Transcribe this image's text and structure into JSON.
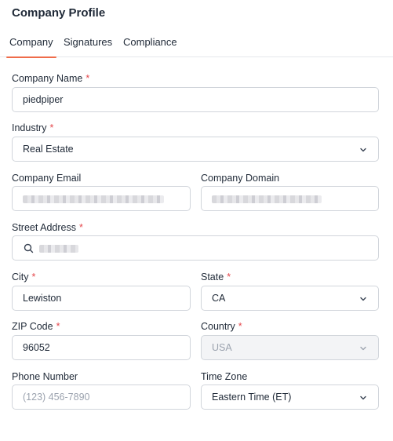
{
  "page": {
    "title": "Company Profile"
  },
  "tabs": [
    {
      "label": "Company",
      "active": true
    },
    {
      "label": "Signatures",
      "active": false
    },
    {
      "label": "Compliance",
      "active": false
    }
  ],
  "required_marker": "*",
  "accent_color": "#ef6c4a",
  "required_color": "#e5484d",
  "form": {
    "company_name": {
      "label": "Company Name",
      "required": true,
      "value": "piedpiper"
    },
    "industry": {
      "label": "Industry",
      "required": true,
      "value": "Real Estate",
      "icon": "chevron-down-icon"
    },
    "company_email": {
      "label": "Company Email",
      "required": false,
      "value_redacted": true
    },
    "company_domain": {
      "label": "Company Domain",
      "required": false,
      "value_redacted": true
    },
    "street_address": {
      "label": "Street Address",
      "required": true,
      "value_redacted": true,
      "icon": "search-icon"
    },
    "city": {
      "label": "City",
      "required": true,
      "value": "Lewiston"
    },
    "state": {
      "label": "State",
      "required": true,
      "value": "CA",
      "icon": "chevron-down-icon"
    },
    "zip_code": {
      "label": "ZIP Code",
      "required": true,
      "value": "96052"
    },
    "country": {
      "label": "Country",
      "required": true,
      "value": "USA",
      "disabled": true,
      "icon": "chevron-down-icon"
    },
    "phone_number": {
      "label": "Phone Number",
      "required": false,
      "value": "",
      "placeholder": "(123) 456-7890"
    },
    "time_zone": {
      "label": "Time Zone",
      "required": false,
      "value": "Eastern Time (ET)",
      "icon": "chevron-down-icon"
    }
  }
}
